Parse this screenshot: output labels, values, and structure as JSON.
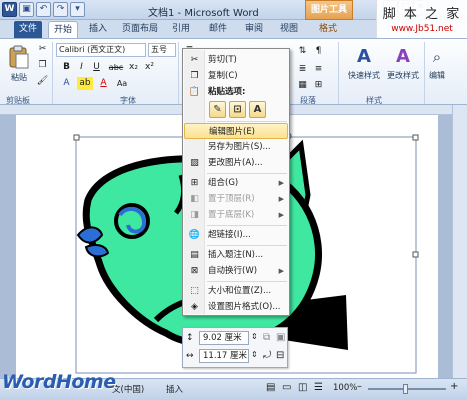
{
  "window": {
    "title": "文档1 - Microsoft Word",
    "contextual_tab_group": "图片工具",
    "qat": {
      "word": "W",
      "save": "▣",
      "undo": "↶",
      "redo": "↷",
      "more": "▾"
    },
    "controls": {
      "minimize": "–",
      "maximize": "□",
      "close": "✕"
    }
  },
  "watermark": {
    "top_line1": "脚 本 之 家",
    "top_line2": "www.Jb51.net",
    "bottom": "WordHome"
  },
  "tabs": [
    {
      "label": "文件"
    },
    {
      "label": "开始"
    },
    {
      "label": "插入"
    },
    {
      "label": "页面布局"
    },
    {
      "label": "引用"
    },
    {
      "label": "邮件"
    },
    {
      "label": "审阅"
    },
    {
      "label": "视图"
    },
    {
      "label": "格式"
    }
  ],
  "ribbon": {
    "clipboard": {
      "paste": "粘贴",
      "label": "剪贴板"
    },
    "font": {
      "name": "Calibri (西文正文)",
      "size": "五号",
      "label": "字体",
      "bold": "B",
      "italic": "I",
      "underline": "U",
      "strike": "abc",
      "subscript": "x₂",
      "superscript": "x²",
      "font_color": "A",
      "highlight": "ab",
      "grow": "A",
      "clear": "Aa"
    },
    "paragraph": {
      "label": "段落"
    },
    "styles": {
      "quick": "快速样式",
      "change": "更改样式",
      "label": "样式"
    },
    "editing": {
      "label": "编辑"
    }
  },
  "context_menu": {
    "items": [
      {
        "label": "剪切(T)",
        "icon": "scissors-icon",
        "glyph": "✂",
        "disabled": false
      },
      {
        "label": "复制(C)",
        "icon": "copy-icon",
        "glyph": "❐",
        "disabled": false
      },
      {
        "label": "粘贴选项:",
        "icon": "paste-icon",
        "glyph": "📋",
        "disabled": false,
        "header": true
      },
      {
        "label": "编辑图片(E)",
        "icon": "",
        "glyph": "",
        "disabled": false,
        "highlighted": true
      },
      {
        "label": "另存为图片(S)...",
        "icon": "",
        "glyph": "",
        "disabled": false
      },
      {
        "label": "更改图片(A)...",
        "icon": "change-picture-icon",
        "glyph": "▨",
        "disabled": false
      },
      {
        "label": "组合(G)",
        "icon": "group-icon",
        "glyph": "⊞",
        "disabled": false,
        "submenu": true
      },
      {
        "label": "置于顶层(R)",
        "icon": "bring-front-icon",
        "glyph": "◧",
        "disabled": true,
        "submenu": true
      },
      {
        "label": "置于底层(K)",
        "icon": "send-back-icon",
        "glyph": "◨",
        "disabled": true,
        "submenu": true
      },
      {
        "label": "超链接(I)...",
        "icon": "hyperlink-icon",
        "glyph": "🌐",
        "disabled": false
      },
      {
        "label": "插入题注(N)...",
        "icon": "caption-icon",
        "glyph": "▤",
        "disabled": false
      },
      {
        "label": "自动换行(W)",
        "icon": "wrap-icon",
        "glyph": "⊠",
        "disabled": false,
        "submenu": true
      },
      {
        "label": "大小和位置(Z)...",
        "icon": "size-icon",
        "glyph": "⬚",
        "disabled": false
      },
      {
        "label": "设置图片格式(O)...",
        "icon": "format-picture-icon",
        "glyph": "◈",
        "disabled": false
      }
    ],
    "paste_buttons": [
      "✎",
      "⊡",
      "A"
    ]
  },
  "mini_toolbar": {
    "height": "9.02 厘米",
    "width": "11.17 厘米"
  },
  "statusbar": {
    "language": "文(中国)",
    "mode": "插入",
    "zoom": "100%",
    "zoom_out": "–",
    "zoom_in": "+"
  },
  "colors": {
    "fish_body": "#3fe8a0",
    "fish_outline": "#000000",
    "fish_eye": "#2b6fd6",
    "accent": "#2b5797",
    "menu_highlight": "#fbe28f"
  }
}
